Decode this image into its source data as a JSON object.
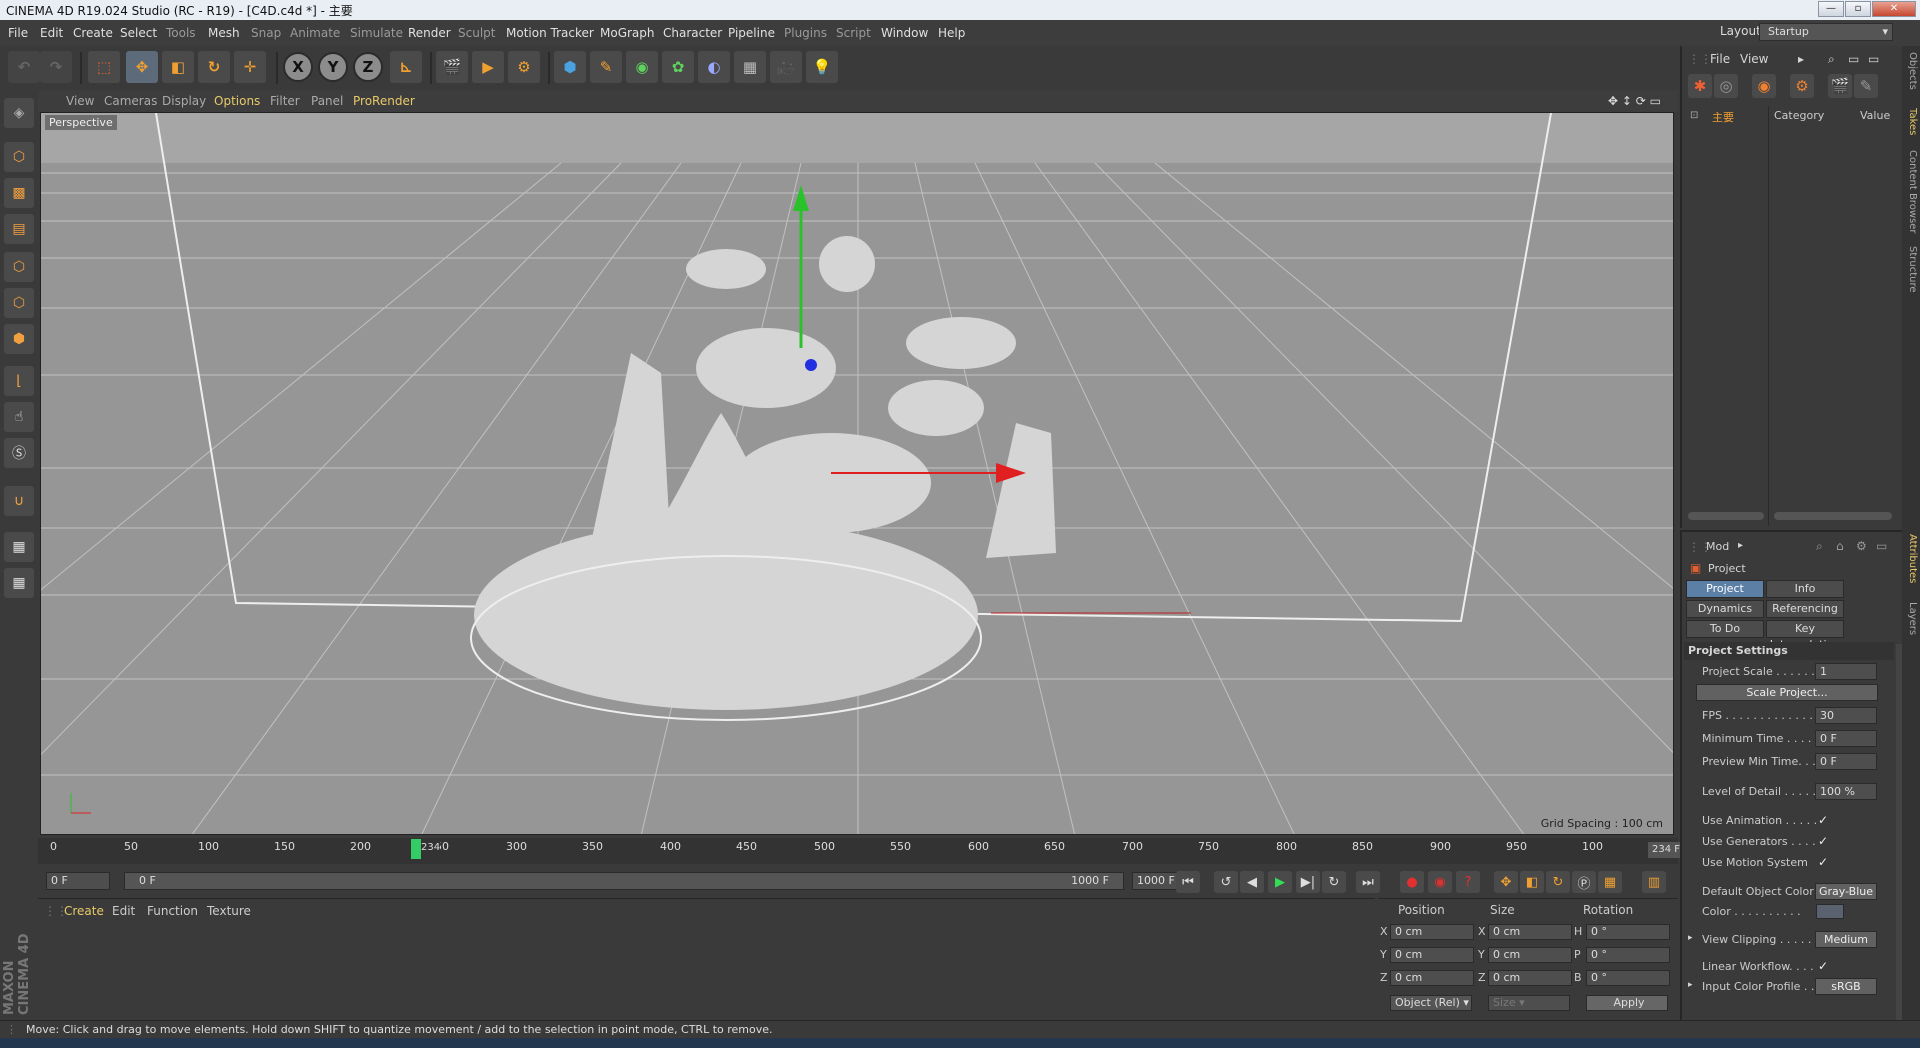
{
  "window": {
    "title": "CINEMA 4D R19.024 Studio (RC - R19) - [C4D.c4d *] - 主要"
  },
  "menubar": {
    "items": [
      "File",
      "Edit",
      "Create",
      "Select",
      "Tools",
      "Mesh",
      "Snap",
      "Animate",
      "Simulate",
      "Render",
      "Sculpt",
      "Motion Tracker",
      "MoGraph",
      "Character",
      "Pipeline",
      "Plugins",
      "Script",
      "Window",
      "Help"
    ],
    "layout_label": "Layout:",
    "layout_value": "Startup"
  },
  "toolbar": {
    "axis_x": "X",
    "axis_y": "Y",
    "axis_z": "Z"
  },
  "viewport": {
    "menu": [
      "View",
      "Cameras",
      "Display",
      "Options",
      "Filter",
      "Panel",
      "ProRender"
    ],
    "camera_label": "Perspective",
    "grid_spacing": "Grid Spacing : 100 cm"
  },
  "timeline": {
    "ticks": [
      "0",
      "50",
      "100",
      "150",
      "200",
      "250",
      "300",
      "350",
      "400",
      "450",
      "500",
      "550",
      "600",
      "650",
      "700",
      "750",
      "800",
      "850",
      "900",
      "950",
      "100"
    ],
    "current_frame": "234",
    "end_frame": "234 F",
    "start_field": "0 F",
    "range_start": "0 F",
    "range_end": "1000 F",
    "end_field": "1000 F"
  },
  "material_manager": {
    "menu": [
      "Create",
      "Edit",
      "Function",
      "Texture"
    ]
  },
  "coordinates": {
    "headers": [
      "Position",
      "Size",
      "Rotation"
    ],
    "rows": [
      {
        "axis": "X",
        "pos": "0 cm",
        "size_axis": "X",
        "size": "0 cm",
        "rot_axis": "H",
        "rot": "0 °"
      },
      {
        "axis": "Y",
        "pos": "0 cm",
        "size_axis": "Y",
        "size": "0 cm",
        "rot_axis": "P",
        "rot": "0 °"
      },
      {
        "axis": "Z",
        "pos": "0 cm",
        "size_axis": "Z",
        "size": "0 cm",
        "rot_axis": "B",
        "rot": "0 °"
      }
    ],
    "object_mode": "Object (Rel)",
    "size_mode": "Size",
    "apply": "Apply"
  },
  "object_manager": {
    "menu": [
      "File",
      "View"
    ],
    "object_name": "主要",
    "col_category": "Category",
    "col_value": "Value"
  },
  "attributes": {
    "mode": "Mod",
    "object": "Project",
    "tabs": [
      "Project Settings",
      "Info",
      "Dynamics",
      "Referencing",
      "To Do",
      "Key Interpolation"
    ],
    "section": "Project Settings",
    "project_scale_label": "Project Scale . . . . . .",
    "project_scale": "1",
    "scale_button": "Scale Project...",
    "fps_label": "FPS . . . . . . . . . . . . .",
    "fps": "30",
    "min_time_label": "Minimum Time . . . . .",
    "min_time": "0 F",
    "preview_min_label": "Preview Min Time. . .",
    "preview_min": "0 F",
    "lod_label": "Level of Detail . . . . .",
    "lod": "100 %",
    "use_animation_label": "Use Animation . . . . .",
    "use_generators_label": "Use Generators . . . .",
    "use_motion_label": "Use Motion System",
    "check": "✓",
    "default_color_label": "Default Object Color",
    "default_color": "Gray-Blue",
    "color_label": "Color . . . . . . . . . .",
    "view_clipping_label": "View Clipping . . . . .",
    "view_clipping": "Medium",
    "linear_workflow_label": "Linear Workflow. . . .",
    "input_profile_label": "Input Color Profile . .",
    "input_profile": "sRGB"
  },
  "side_tabs": [
    "Objects",
    "Takes",
    "Content Browser",
    "Structure",
    "Attributes",
    "Layers"
  ],
  "status": {
    "text": "Move: Click and drag to move elements. Hold down SHIFT to quantize movement / add to the selection in point mode, CTRL to remove."
  },
  "branding": {
    "text": "MAXON CINEMA 4D"
  }
}
